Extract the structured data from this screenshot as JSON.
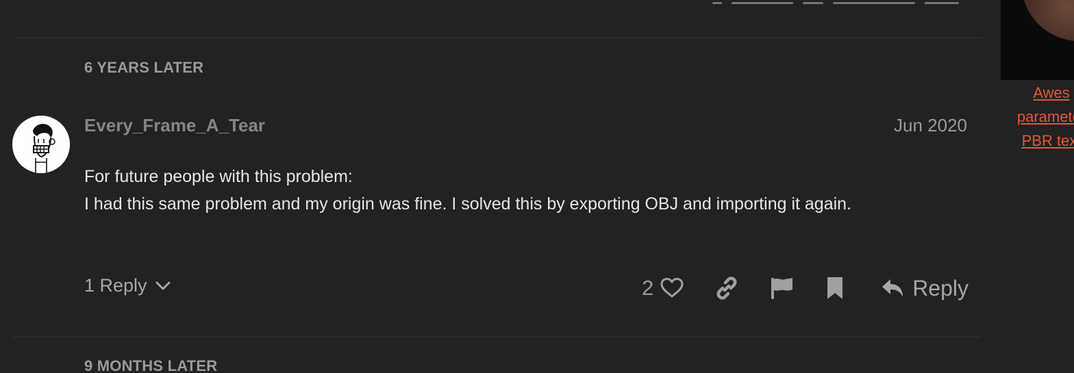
{
  "timeline": {
    "gap_label_1": "6 YEARS LATER",
    "gap_label_2": "9 MONTHS LATER"
  },
  "post": {
    "author": "Every_Frame_A_Tear",
    "date": "Jun 2020",
    "body": [
      "For future people with this problem:",
      "I had this same problem and my origin was fine. I solved this by exporting OBJ and importing it again."
    ],
    "replies_label": "1 Reply",
    "like_count": "2",
    "reply_label": "Reply"
  },
  "sidebar": {
    "caption_lines": [
      "Awes",
      "parameter",
      "PBR text"
    ]
  },
  "colors": {
    "background": "#222222",
    "accent_link": "#e45735",
    "body_text": "#e6e6e6",
    "muted_text": "#9a9a9a"
  },
  "icons": [
    "avatar-cartoon",
    "chevron-down-icon",
    "heart-icon",
    "link-icon",
    "flag-icon",
    "bookmark-icon",
    "reply-arrow-icon"
  ]
}
